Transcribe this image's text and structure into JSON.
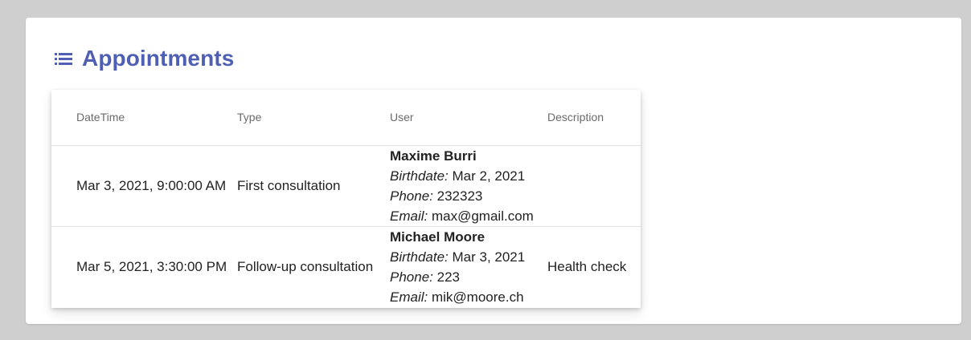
{
  "page": {
    "title": "Appointments",
    "title_icon": "list-icon",
    "accent_color": "#4f5fb4"
  },
  "table": {
    "columns": [
      {
        "label": "DateTime"
      },
      {
        "label": "Type"
      },
      {
        "label": "User"
      },
      {
        "label": "Description"
      }
    ],
    "rows": [
      {
        "datetime": "Mar 3, 2021, 9:00:00 AM",
        "type": "First consultation",
        "user": {
          "name": "Maxime Burri",
          "birthdate_label": "Birthdate:",
          "birthdate": "Mar 2, 2021",
          "phone_label": "Phone:",
          "phone": "232323",
          "email_label": "Email:",
          "email": "max@gmail.com"
        },
        "description": ""
      },
      {
        "datetime": "Mar 5, 2021, 3:30:00 PM",
        "type": "Follow-up consultation",
        "user": {
          "name": "Michael Moore",
          "birthdate_label": "Birthdate:",
          "birthdate": "Mar 3, 2021",
          "phone_label": "Phone:",
          "phone": "223",
          "email_label": "Email:",
          "email": "mik@moore.ch"
        },
        "description": "Health check"
      }
    ]
  }
}
